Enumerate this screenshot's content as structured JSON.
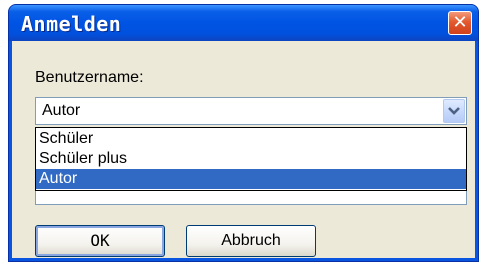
{
  "window": {
    "title": "Anmelden",
    "close_label": "✕"
  },
  "form": {
    "username_label": "Benutzername:",
    "username_value": "Autor",
    "options": [
      "Schüler",
      "Schüler plus",
      "Autor"
    ],
    "selected_option": "Autor"
  },
  "buttons": {
    "ok": "OK",
    "cancel": "Abbruch"
  },
  "colors": {
    "title_bar": "#0054e3",
    "selection": "#316ac5",
    "client_bg": "#ece9d8",
    "close_button": "#e35a2e"
  },
  "icons": {
    "close": "close-icon",
    "dropdown": "chevron-down-icon"
  }
}
